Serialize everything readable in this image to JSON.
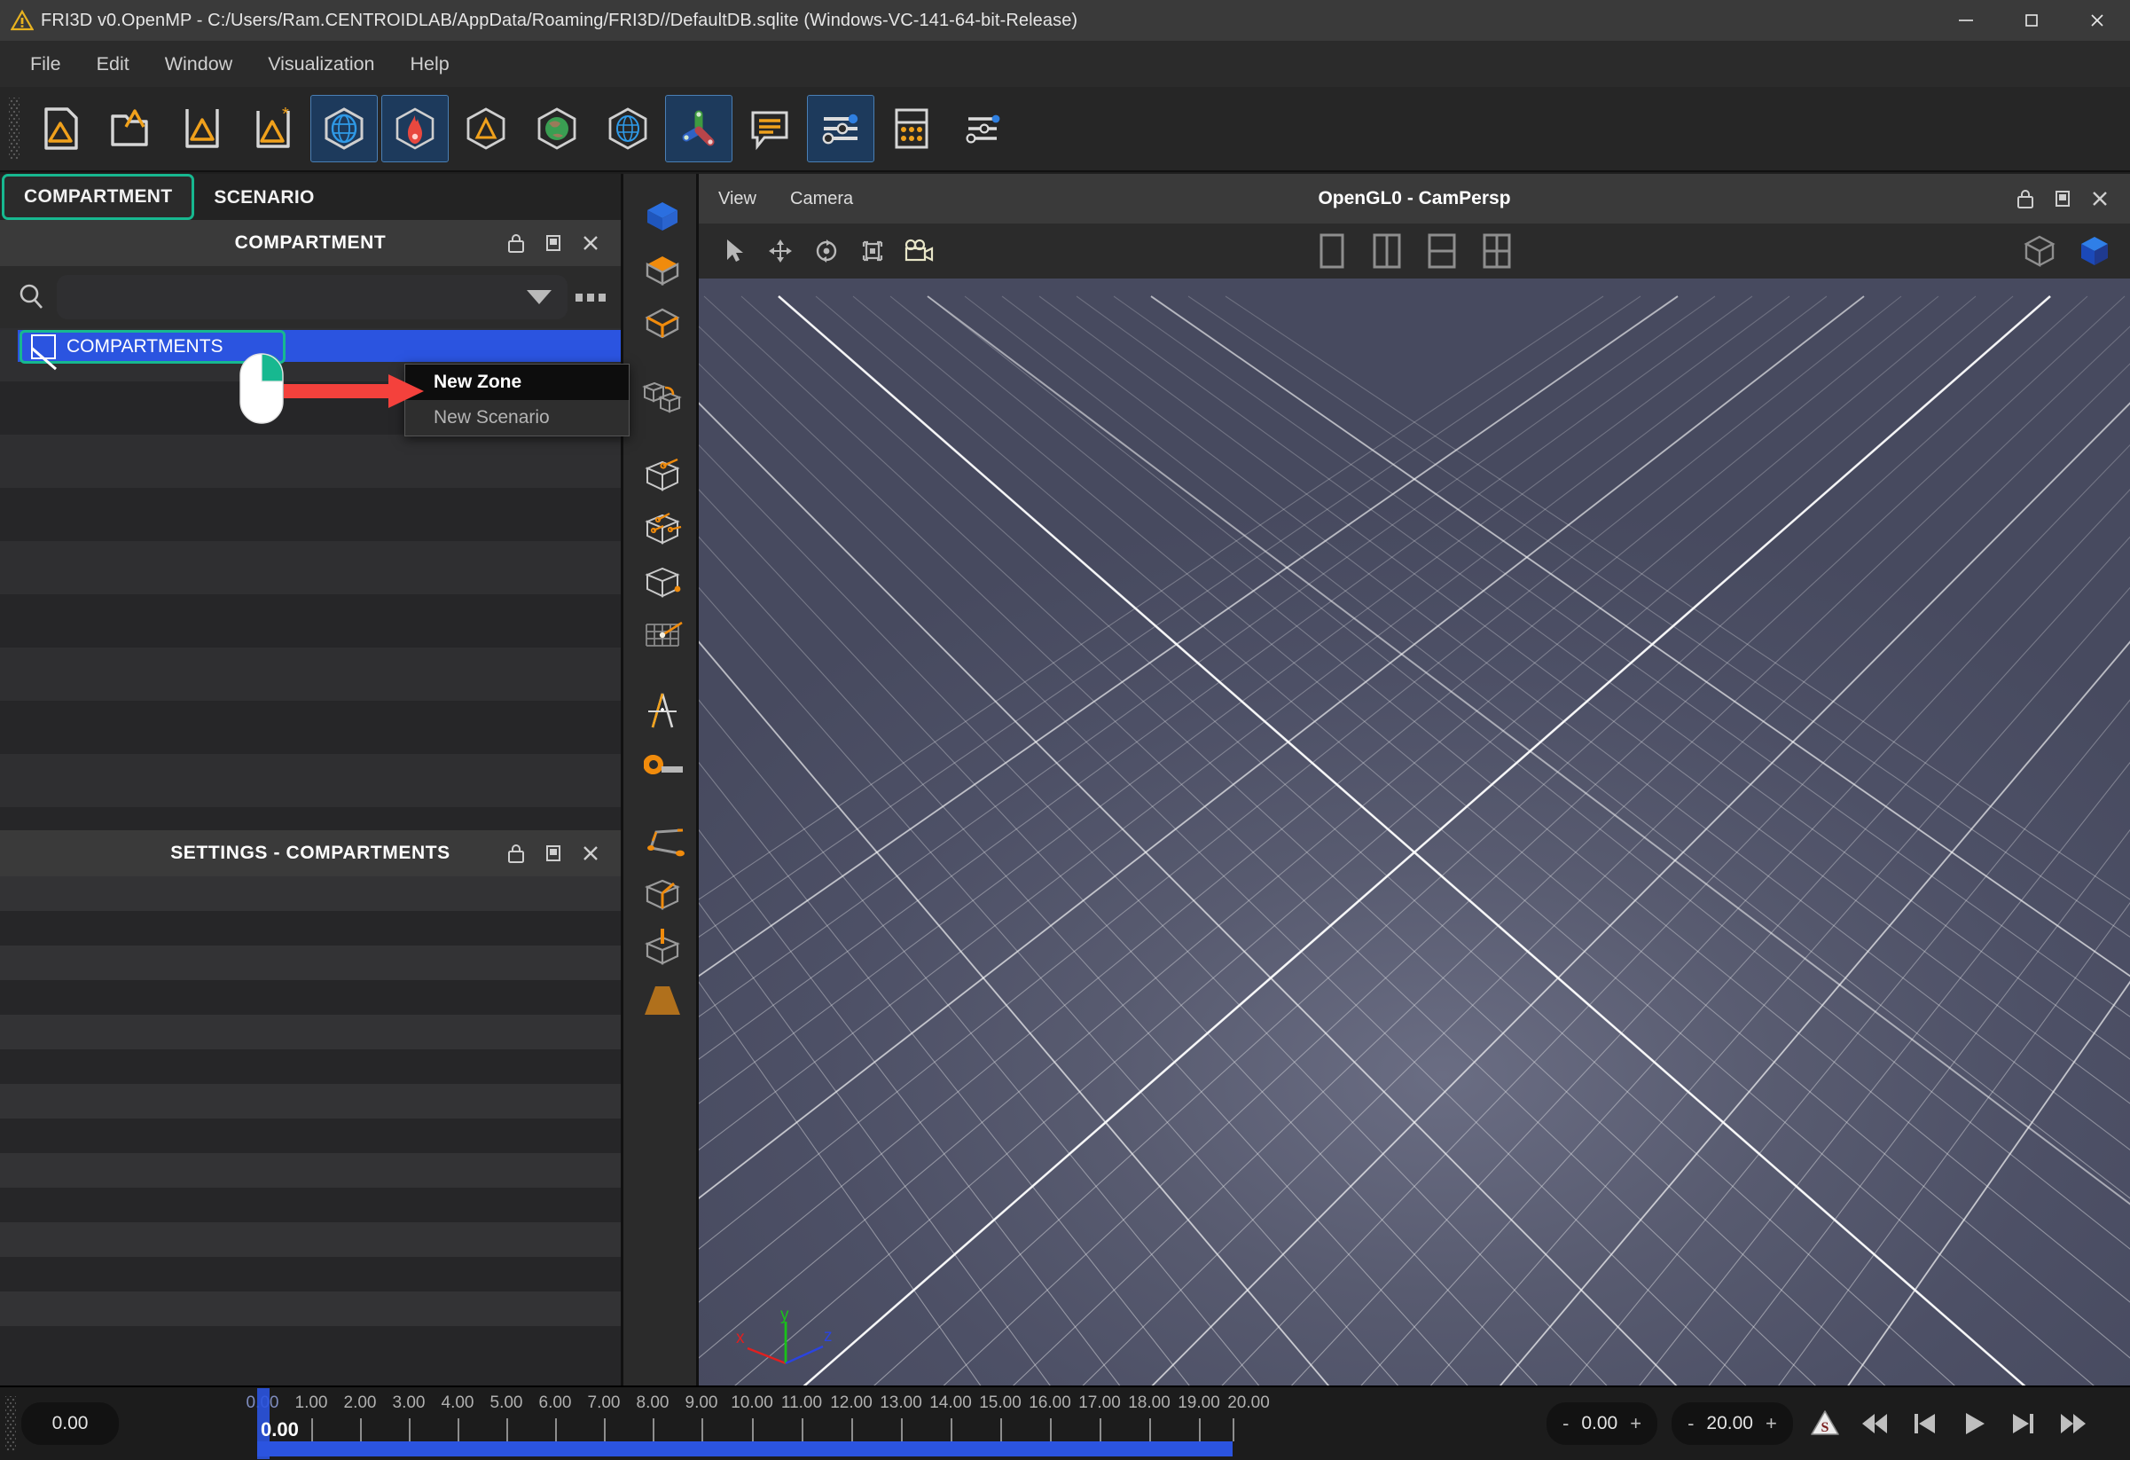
{
  "window": {
    "title": "FRI3D v0.OpenMP - C:/Users/Ram.CENTROIDLAB/AppData/Roaming/FRI3D//DefaultDB.sqlite (Windows-VC-141-64-bit-Release)",
    "warning_icon": "warning-triangle-icon",
    "minimize": "—",
    "maximize": "▢",
    "close": "✕"
  },
  "menubar": {
    "items": [
      {
        "label": "File"
      },
      {
        "label": "Edit"
      },
      {
        "label": "Window"
      },
      {
        "label": "Visualization"
      },
      {
        "label": "Help"
      }
    ]
  },
  "toolbar": {
    "buttons": [
      {
        "name": "new-file-icon",
        "active": false
      },
      {
        "name": "open-file-icon",
        "active": false
      },
      {
        "name": "save-file-icon",
        "active": false
      },
      {
        "name": "save-as-file-icon",
        "active": false
      },
      {
        "name": "mesh-globe-box-icon",
        "active": true
      },
      {
        "name": "fire-box-icon",
        "active": true
      },
      {
        "name": "geometry-box-icon",
        "active": false
      },
      {
        "name": "earth-box-icon",
        "active": false
      },
      {
        "name": "wireframe-globe-box-icon",
        "active": false
      },
      {
        "name": "axes-gizmo-icon",
        "active": true
      },
      {
        "name": "annotation-icon",
        "active": false
      },
      {
        "name": "sliders-panel-icon",
        "active": true
      },
      {
        "name": "keypad-icon",
        "active": false
      },
      {
        "name": "settings-sliders-icon",
        "active": false
      }
    ]
  },
  "left_dock": {
    "tabs": [
      {
        "label": "COMPARTMENT",
        "selected": true
      },
      {
        "label": "SCENARIO",
        "selected": false
      }
    ],
    "compartment_panel": {
      "title": "COMPARTMENT",
      "header_buttons": [
        "lock-icon",
        "float-icon",
        "close-icon"
      ],
      "search": {
        "value": "",
        "placeholder": ""
      },
      "dropdown_icon": "chevron-down-icon",
      "overflow_icon": "more-options-icon",
      "tree": {
        "root": {
          "label": "COMPARTMENTS",
          "icon": "compartment-node-icon",
          "selected": true
        }
      }
    },
    "settings_panel": {
      "title": "SETTINGS - COMPARTMENTS",
      "header_buttons": [
        "lock-icon",
        "float-icon",
        "close-icon"
      ]
    }
  },
  "context_menu": {
    "items": [
      {
        "label": "New Zone",
        "highlighted": true
      },
      {
        "label": "New Scenario",
        "highlighted": false
      }
    ]
  },
  "annotation": {
    "mouse_icon": "mouse-right-click-icon",
    "arrow_icon": "red-arrow-icon",
    "arrow_color": "#f4413c",
    "highlight_color": "#17b890"
  },
  "vertical_toolbar": {
    "buttons": [
      {
        "name": "box-solid-blue-icon"
      },
      {
        "name": "box-top-face-icon"
      },
      {
        "name": "box-edges-icon"
      },
      {
        "name": "link-boxes-icon"
      },
      {
        "name": "box-vent-single-icon"
      },
      {
        "name": "box-vent-multi-icon"
      },
      {
        "name": "box-corner-point-icon"
      },
      {
        "name": "grid-point-icon"
      },
      {
        "name": "compass-divider-icon"
      },
      {
        "name": "measure-tape-icon"
      },
      {
        "name": "polyline-path-icon"
      },
      {
        "name": "box-slice-icon"
      },
      {
        "name": "box-pin-icon"
      },
      {
        "name": "ramp-surface-icon"
      }
    ]
  },
  "viewport": {
    "menus": [
      {
        "label": "View"
      },
      {
        "label": "Camera"
      }
    ],
    "title": "OpenGL0 - CamPersp",
    "header_buttons": [
      "lock-icon",
      "float-icon",
      "close-icon"
    ],
    "tools": [
      {
        "name": "select-arrow-icon"
      },
      {
        "name": "pan-move-icon"
      },
      {
        "name": "rotate-orbit-icon"
      },
      {
        "name": "zoom-fit-icon"
      },
      {
        "name": "camera-record-icon"
      }
    ],
    "layouts": [
      {
        "name": "layout-single-icon"
      },
      {
        "name": "layout-two-columns-icon"
      },
      {
        "name": "layout-two-rows-icon"
      },
      {
        "name": "layout-quad-icon"
      }
    ],
    "right_tools": [
      {
        "name": "wireframe-cube-icon"
      },
      {
        "name": "solid-cube-icon"
      }
    ],
    "axes": [
      {
        "label": "x",
        "color": "#e02020"
      },
      {
        "label": "y",
        "color": "#19c219"
      },
      {
        "label": "z",
        "color": "#2b44e0"
      }
    ]
  },
  "timeline": {
    "current_time_pill": "0.00",
    "current_time_label": "0.00",
    "ticks": [
      "0.00",
      "1.00",
      "2.00",
      "3.00",
      "4.00",
      "5.00",
      "6.00",
      "7.00",
      "8.00",
      "9.00",
      "10.00",
      "11.00",
      "12.00",
      "13.00",
      "14.00",
      "15.00",
      "16.00",
      "17.00",
      "18.00",
      "19.00",
      "20.00"
    ],
    "start_stepper": {
      "minus": "-",
      "value": "0.00",
      "plus": "+"
    },
    "end_stepper": {
      "minus": "-",
      "value": "20.00",
      "plus": "+"
    },
    "transport": [
      {
        "name": "scenario-badge-icon",
        "label": "S"
      },
      {
        "name": "skip-to-start-icon"
      },
      {
        "name": "previous-frame-icon"
      },
      {
        "name": "play-icon"
      },
      {
        "name": "next-frame-icon"
      },
      {
        "name": "skip-to-end-icon"
      }
    ]
  }
}
